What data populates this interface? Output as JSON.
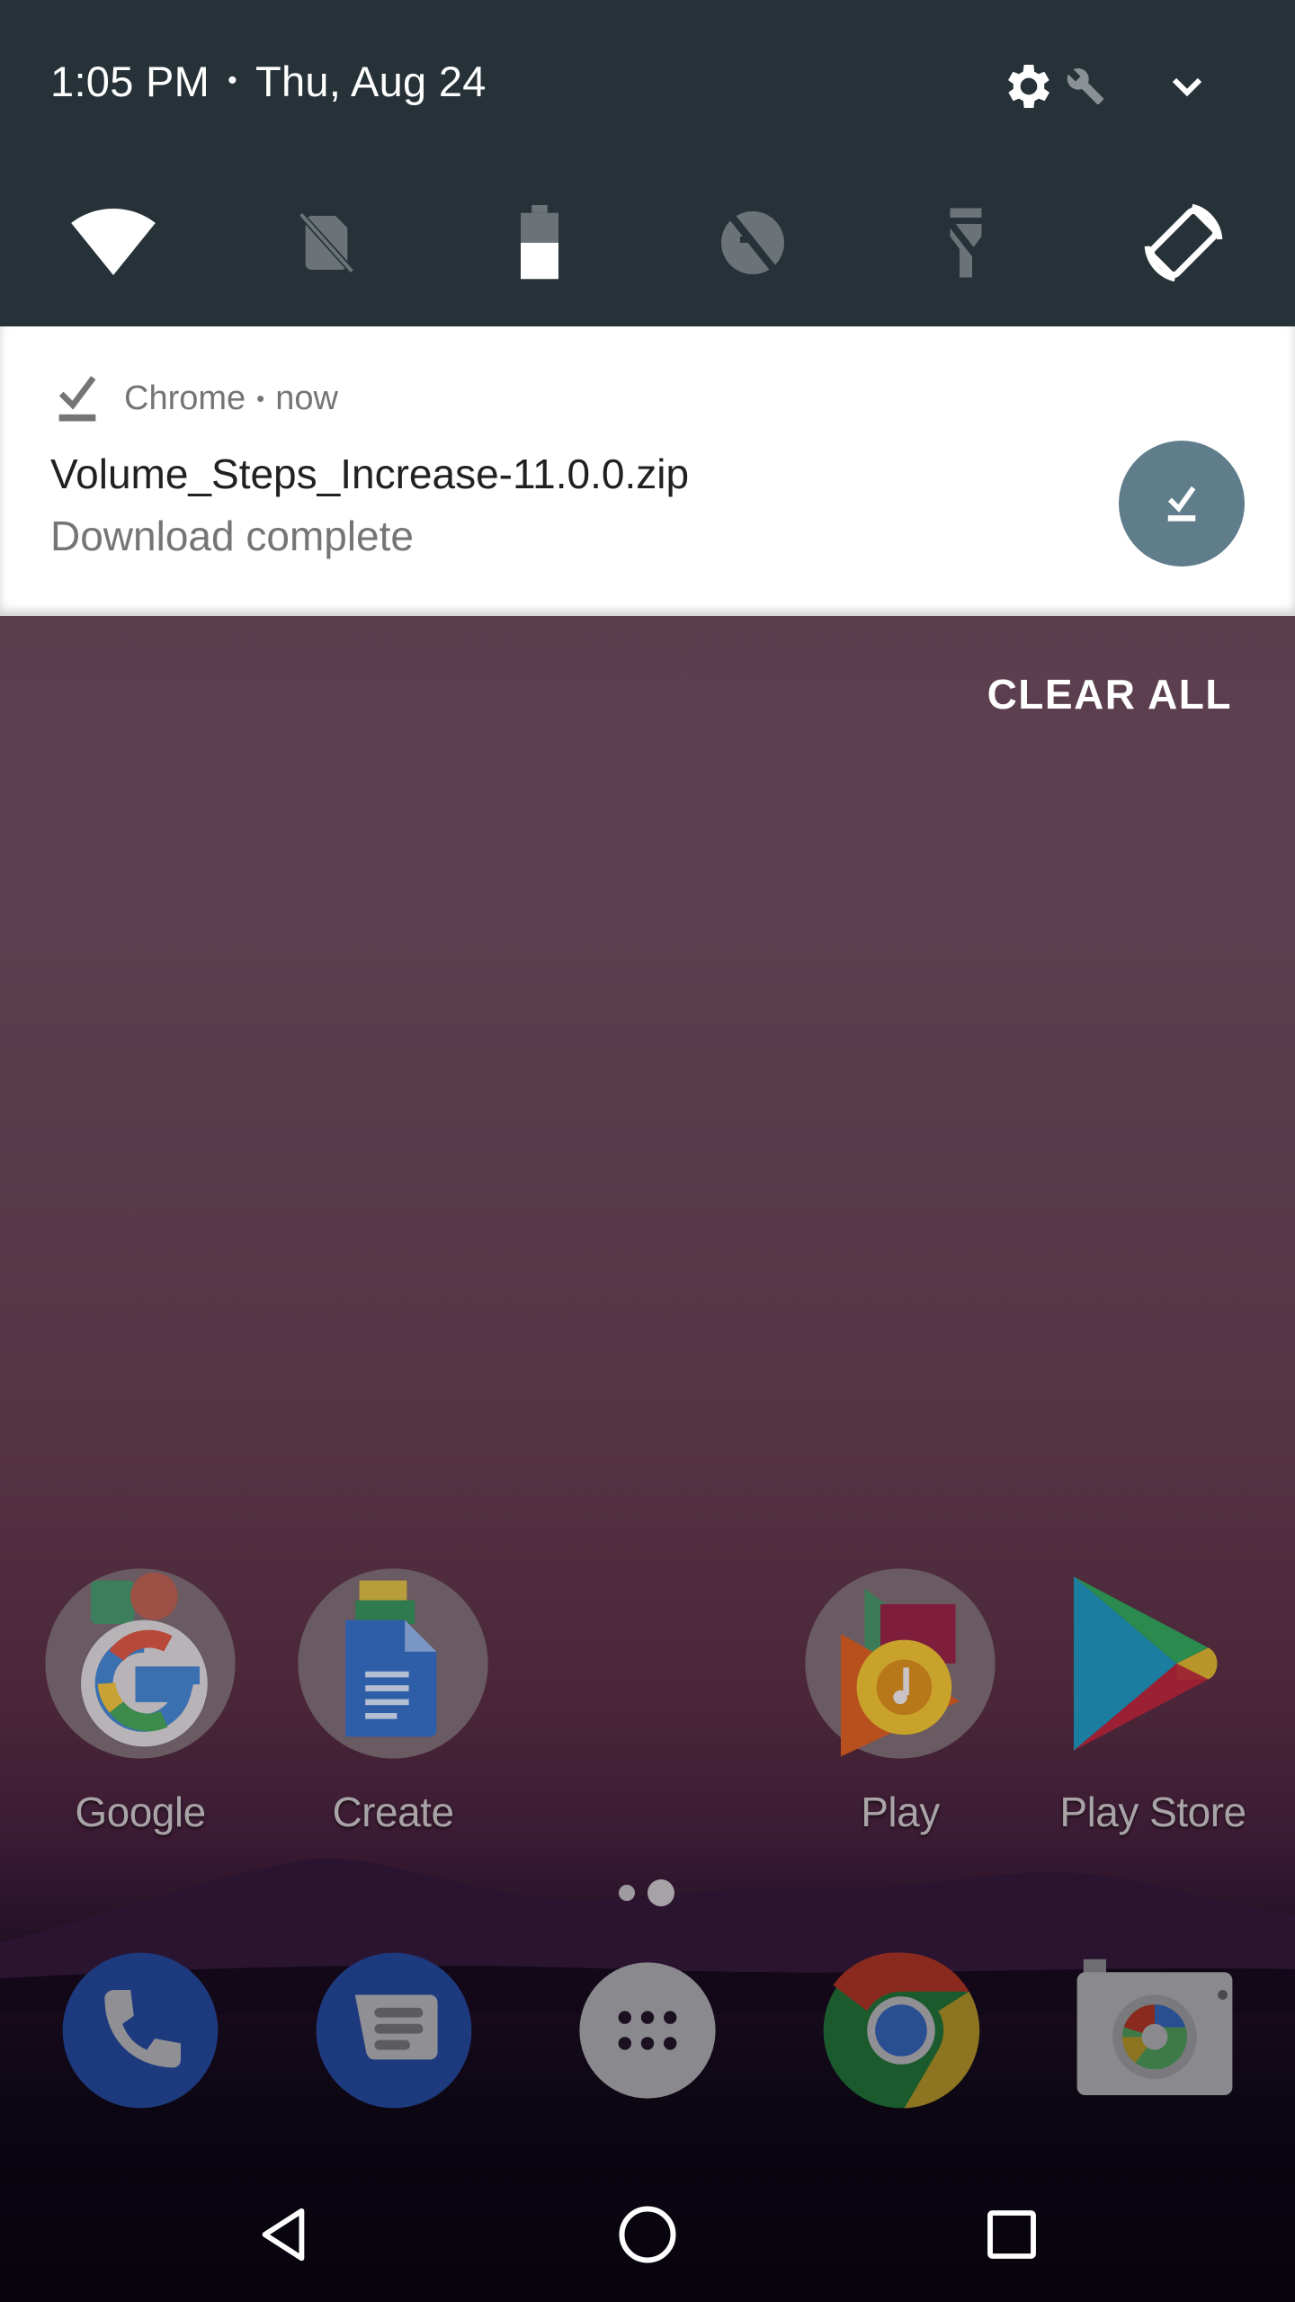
{
  "status": {
    "time": "1:05 PM",
    "separator": "•",
    "date": "Thu, Aug 24",
    "actions": [
      {
        "name": "settings",
        "icon": "gear-icon"
      },
      {
        "name": "system-ui-tuner",
        "icon": "wrench-icon"
      },
      {
        "name": "expand",
        "icon": "chevron-down-icon"
      }
    ]
  },
  "quick_tiles": [
    {
      "name": "wifi",
      "icon": "wifi-icon",
      "state": "on"
    },
    {
      "name": "no-sim",
      "icon": "no-sim-icon",
      "state": "off"
    },
    {
      "name": "battery",
      "icon": "battery-icon",
      "state": "on",
      "level": 0.45
    },
    {
      "name": "data-saver",
      "icon": "data-saver-off-icon",
      "state": "off"
    },
    {
      "name": "flashlight",
      "icon": "flashlight-off-icon",
      "state": "off"
    },
    {
      "name": "auto-rotate",
      "icon": "auto-rotate-icon",
      "state": "on"
    }
  ],
  "notification": {
    "app": "Chrome",
    "separator": "•",
    "when": "now",
    "title": "Volume_Steps_Increase-11.0.0.zip",
    "subtitle": "Download complete",
    "accent_color": "#607d8b"
  },
  "clear_all_label": "CLEAR ALL",
  "home_apps": [
    {
      "label": "Google",
      "icon": "google-folder-icon"
    },
    {
      "label": "Create",
      "icon": "create-folder-icon"
    },
    {
      "label": "Play",
      "icon": "play-folder-icon"
    },
    {
      "label": "Play Store",
      "icon": "play-store-icon"
    }
  ],
  "pager": {
    "pages": 2,
    "current": 2
  },
  "dock": [
    {
      "name": "phone",
      "icon": "phone-icon"
    },
    {
      "name": "messages",
      "icon": "messages-icon"
    },
    {
      "name": "app-drawer",
      "icon": "app-drawer-icon"
    },
    {
      "name": "chrome",
      "icon": "chrome-icon"
    },
    {
      "name": "camera",
      "icon": "camera-icon"
    }
  ],
  "navbar": [
    {
      "name": "back",
      "icon": "back-icon"
    },
    {
      "name": "home",
      "icon": "home-icon"
    },
    {
      "name": "recents",
      "icon": "recents-icon"
    }
  ]
}
